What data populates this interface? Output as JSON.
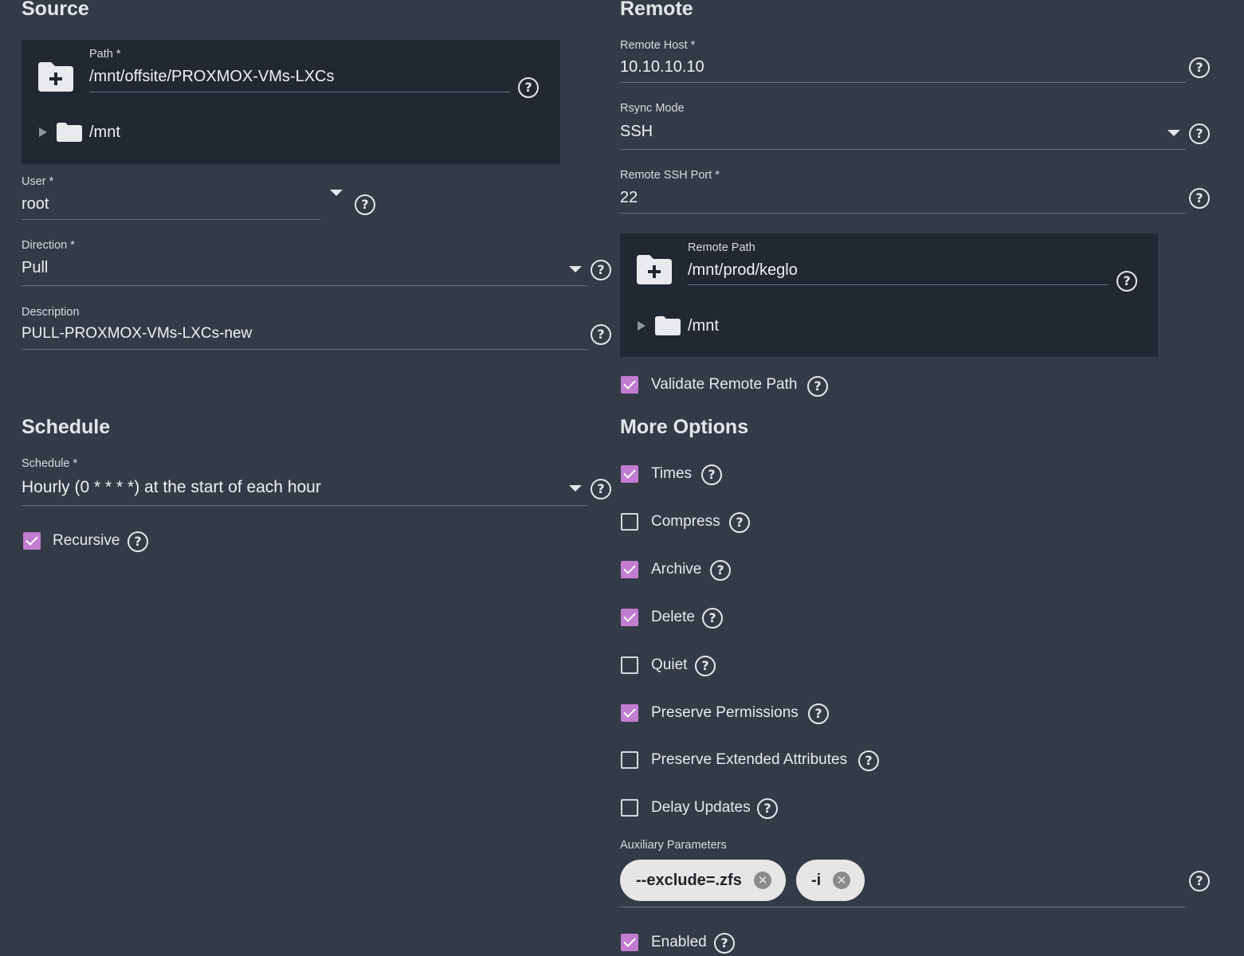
{
  "source": {
    "title": "Source",
    "path": {
      "label": "Path *",
      "value": "/mnt/offsite/PROXMOX-VMs-LXCs",
      "tree_root": "/mnt"
    },
    "user": {
      "label": "User *",
      "value": "root"
    },
    "direction": {
      "label": "Direction *",
      "value": "Pull"
    },
    "description": {
      "label": "Description",
      "value": "PULL-PROXMOX-VMs-LXCs-new"
    }
  },
  "schedule": {
    "title": "Schedule",
    "schedule": {
      "label": "Schedule *",
      "value": "Hourly (0 * * * *) at the start of each hour"
    },
    "recursive": {
      "label": "Recursive",
      "checked": true
    }
  },
  "remote": {
    "title": "Remote",
    "host": {
      "label": "Remote Host *",
      "value": "10.10.10.10"
    },
    "rsync_mode": {
      "label": "Rsync Mode",
      "value": "SSH"
    },
    "ssh_port": {
      "label": "Remote SSH Port *",
      "value": "22"
    },
    "remote_path": {
      "label": "Remote Path",
      "value": "/mnt/prod/keglo",
      "tree_root": "/mnt"
    },
    "validate": {
      "label": "Validate Remote Path",
      "checked": true
    }
  },
  "more_options": {
    "title": "More Options",
    "options": [
      {
        "label": "Times",
        "checked": true
      },
      {
        "label": "Compress",
        "checked": false
      },
      {
        "label": "Archive",
        "checked": true
      },
      {
        "label": "Delete",
        "checked": true
      },
      {
        "label": "Quiet",
        "checked": false
      },
      {
        "label": "Preserve Permissions",
        "checked": true
      },
      {
        "label": "Preserve Extended Attributes",
        "checked": false
      },
      {
        "label": "Delay Updates",
        "checked": false
      }
    ],
    "aux": {
      "label": "Auxiliary Parameters",
      "chips": [
        "--exclude=.zfs",
        "-i"
      ]
    },
    "enabled": {
      "label": "Enabled",
      "checked": true
    }
  },
  "icons": {
    "help": "?",
    "remove": "✕"
  },
  "colors": {
    "background": "#333b46",
    "panel": "#222832",
    "checkbox_accent": "#c27cd0"
  }
}
